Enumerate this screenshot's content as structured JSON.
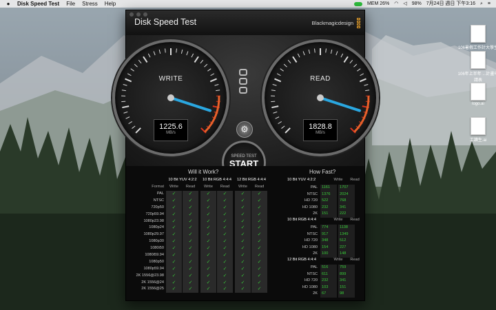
{
  "menubar": {
    "app_name": "Disk Speed Test",
    "items": [
      "File",
      "Stress",
      "Help"
    ],
    "status": {
      "battery": "98%",
      "datetime": "7月24日 週日 下午3:16",
      "mem": "MEM 26%"
    }
  },
  "desktop_icons": [
    {
      "label": "106暑假工作計大學生研究"
    },
    {
      "label": "106年上半年 ...計畫申請表"
    },
    {
      "label": "logo.ai"
    },
    {
      "label": "工讀生.ai"
    }
  ],
  "window": {
    "title": "Disk Speed Test",
    "brand": "Blackmagicdesign"
  },
  "gauges": {
    "write": {
      "label": "WRITE",
      "value": "1225.6",
      "unit": "MB/s",
      "level": 1225.6
    },
    "read": {
      "label": "READ",
      "value": "1828.8",
      "unit": "MB/s",
      "level": 1828.8
    }
  },
  "start_button": {
    "top": "SPEED TEST",
    "main": "START"
  },
  "will_it_work": {
    "title": "Will it Work?",
    "groups": [
      "10 Bit YUV 4:2:2",
      "10 Bit RGB 4:4:4",
      "12 Bit RGB 4:4:4"
    ],
    "format_label": "Format",
    "write_label": "Write",
    "read_label": "Read",
    "check": "✓",
    "formats": [
      "PAL",
      "NTSC",
      "720p50",
      "720p59.94",
      "1080p23.98",
      "1080p24",
      "1080p29.97",
      "1080p30",
      "1080i50",
      "1080i59.94",
      "1080p50",
      "1080p59.94",
      "2K 1556@23.98",
      "2K 1556@24",
      "2K 1556@25"
    ]
  },
  "how_fast": {
    "title": "How Fast?",
    "write_label": "Write",
    "read_label": "Read",
    "groups": [
      {
        "name": "10 Bit YUV 4:2:2",
        "rows": [
          {
            "format": "PAL",
            "write": "1161",
            "read": "1707"
          },
          {
            "format": "NTSC",
            "write": "1376",
            "read": "2024"
          },
          {
            "format": "HD 720",
            "write": "522",
            "read": "768"
          },
          {
            "format": "HD 1080",
            "write": "232",
            "read": "341"
          },
          {
            "format": "2K",
            "write": "151",
            "read": "222"
          }
        ]
      },
      {
        "name": "10 Bit RGB 4:4:4",
        "rows": [
          {
            "format": "PAL",
            "write": "774",
            "read": "1138"
          },
          {
            "format": "NTSC",
            "write": "917",
            "read": "1349"
          },
          {
            "format": "HD 720",
            "write": "348",
            "read": "512"
          },
          {
            "format": "HD 1080",
            "write": "154",
            "read": "227"
          },
          {
            "format": "2K",
            "write": "100",
            "read": "148"
          }
        ]
      },
      {
        "name": "12 Bit RGB 4:4:4",
        "rows": [
          {
            "format": "PAL",
            "write": "516",
            "read": "759"
          },
          {
            "format": "NTSC",
            "write": "611",
            "read": "899"
          },
          {
            "format": "HD 720",
            "write": "232",
            "read": "341"
          },
          {
            "format": "HD 1080",
            "write": "103",
            "read": "151"
          },
          {
            "format": "2K",
            "write": "67",
            "read": "98"
          }
        ]
      }
    ]
  },
  "colors": {
    "accent_green": "#39d139",
    "needle_blue": "#2aa7e0",
    "brand_orange": "#e8a02a"
  }
}
